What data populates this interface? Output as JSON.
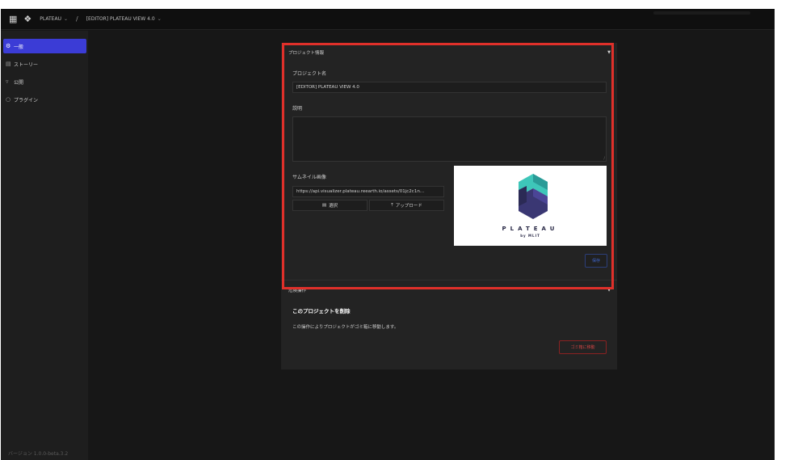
{
  "topbar": {
    "workspace": "PLATEAU",
    "separator": "/",
    "project": "[EDITOR] PLATEAU VIEW 4.0"
  },
  "sidebar": {
    "items": [
      {
        "label": "一般",
        "icon": "gear-icon",
        "active": true
      },
      {
        "label": "ストーリー",
        "icon": "book-icon",
        "active": false
      },
      {
        "label": "公開",
        "icon": "send-icon",
        "active": false
      },
      {
        "label": "プラグイン",
        "icon": "puzzle-icon",
        "active": false
      }
    ],
    "version": "バージョン 1.0.0-beta.3.2"
  },
  "project_info": {
    "header": "プロジェクト情報",
    "name_label": "プロジェクト名",
    "name_value": "[EDITOR] PLATEAU VIEW 4.0",
    "desc_label": "説明",
    "desc_value": "",
    "thumb_label": "サムネイル画像",
    "thumb_url": "https://api.visualizer.plateau.reearth.io/assets/01jc2c1n...",
    "select_label": "選択",
    "upload_label": "アップロード",
    "logo_text": "PLATEAU",
    "logo_sub": "by MLIT",
    "save_label": "保存"
  },
  "danger_zone": {
    "header": "危険操作",
    "title": "このプロジェクトを削除",
    "description": "この操作によりプロジェクトがゴミ箱に移動します。",
    "trash_label": "ゴミ箱に移動"
  },
  "colors": {
    "accent": "#3b3cd6",
    "highlight": "#e0302a",
    "danger": "#cc4444"
  }
}
